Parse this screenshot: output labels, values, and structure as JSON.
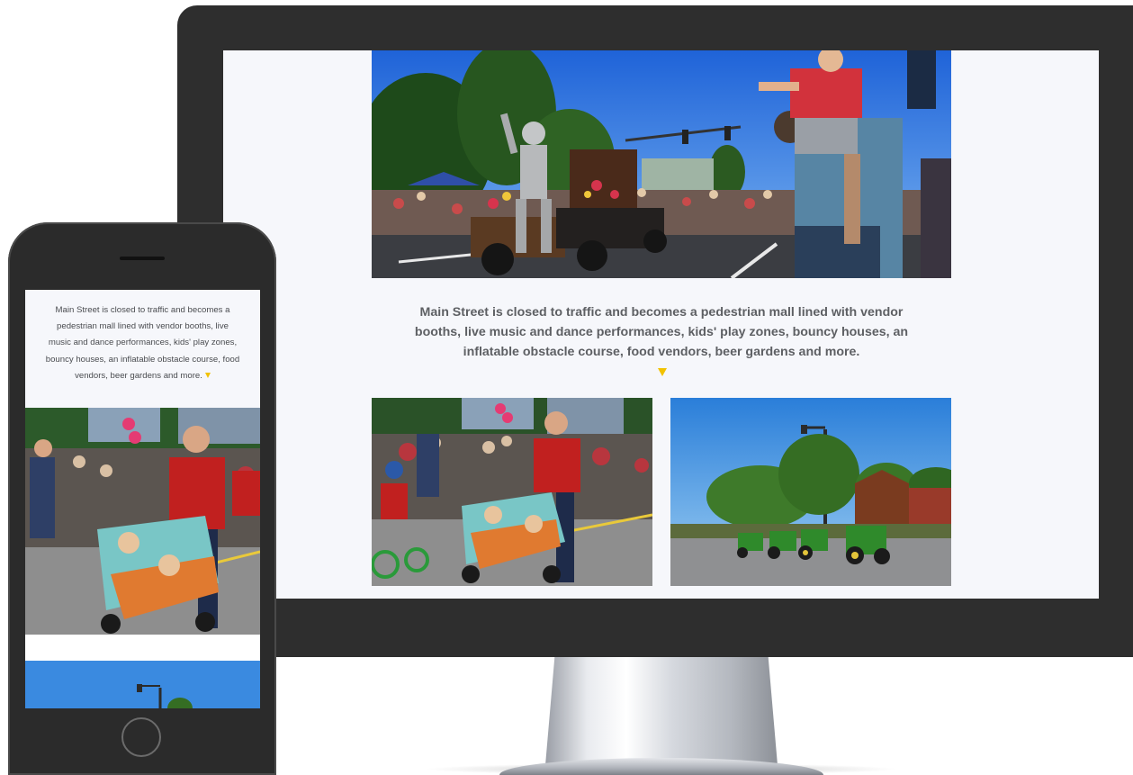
{
  "description_text": "Main Street is closed to traffic and becomes a pedestrian mall lined with vendor booths, live music and dance performances, kids' play zones, bouncy houses, an inflatable obstacle course, food vendors, beer gardens and more.",
  "colors": {
    "accent_arrow": "#f2c200",
    "screen_background": "#f6f7fb",
    "text_gray": "#5d5f63",
    "device_frame": "#2e2e2e"
  },
  "icons": {
    "scroll_indicator": "down-triangle-icon"
  }
}
